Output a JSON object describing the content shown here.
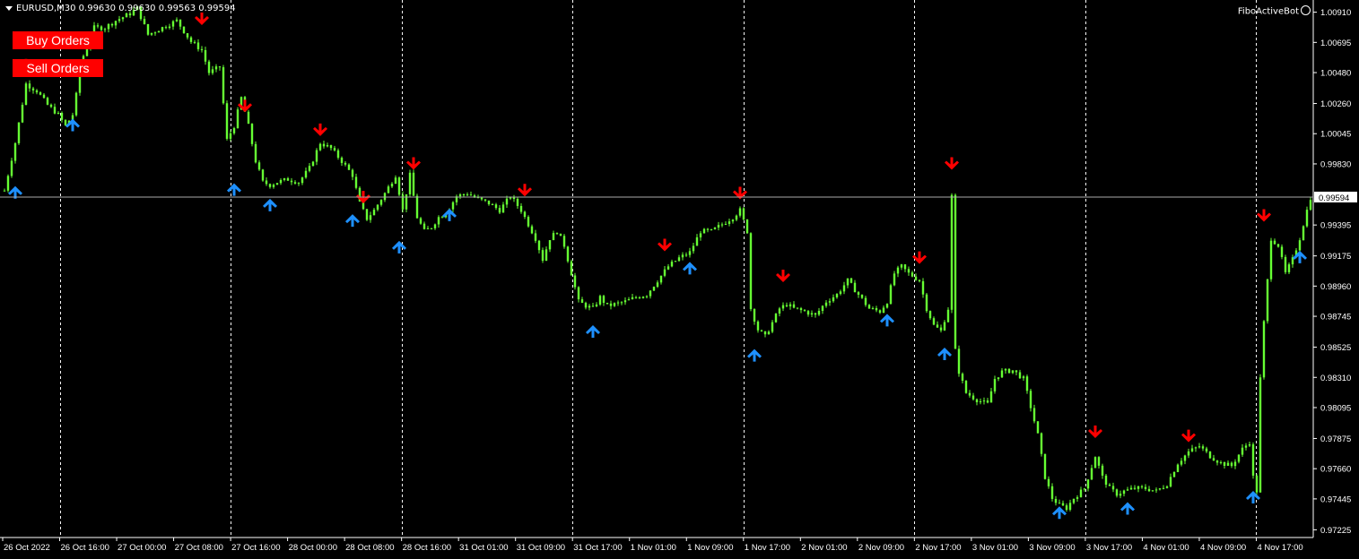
{
  "header": {
    "symbol_line": "EURUSD,M30  0.99630 0.99630 0.99563 0.99594",
    "bot_name": "FiboActiveBot"
  },
  "buttons": {
    "buy_label": "Buy Orders",
    "sell_label": "Sell Orders"
  },
  "colors": {
    "background": "#000000",
    "candles": "#66ff33",
    "down_arrow": "#ff0000",
    "up_arrow": "#1e90ff",
    "grid": "#ffffff",
    "button": "#ff0000"
  },
  "icons": {
    "buy_signal": "blue-up-arrow-icon",
    "sell_signal": "red-down-arrow-icon",
    "dropdown": "triangle-down-icon",
    "bot": "smiley-icon"
  },
  "chart_data": {
    "type": "candlestick",
    "symbol": "EURUSD",
    "timeframe": "M30",
    "grid": "vertical-dashed",
    "current_price": 0.99594,
    "current_price_label": "0.99594",
    "ylim": [
      0.9717,
      1.00965
    ],
    "y_ticks": [
      "1.00910",
      "1.00695",
      "1.00480",
      "1.00260",
      "1.00045",
      "0.99830",
      "0.99395",
      "0.99175",
      "0.98960",
      "0.98745",
      "0.98525",
      "0.98310",
      "0.98095",
      "0.97875",
      "0.97660",
      "0.97445",
      "0.97225"
    ],
    "x_ticks": [
      "26 Oct 2022",
      "26 Oct 16:00",
      "27 Oct 00:00",
      "27 Oct 08:00",
      "27 Oct 16:00",
      "28 Oct 00:00",
      "28 Oct 08:00",
      "28 Oct 16:00",
      "31 Oct 01:00",
      "31 Oct 09:00",
      "31 Oct 17:00",
      "1 Nov 01:00",
      "1 Nov 09:00",
      "1 Nov 17:00",
      "2 Nov 01:00",
      "2 Nov 09:00",
      "2 Nov 17:00",
      "3 Nov 01:00",
      "3 Nov 09:00",
      "3 Nov 17:00",
      "4 Nov 01:00",
      "4 Nov 09:00",
      "4 Nov 17:00"
    ],
    "bars_total": 365,
    "price_path": [
      [
        0,
        0.9964
      ],
      [
        3,
        0.9998
      ],
      [
        6,
        1.004
      ],
      [
        9,
        1.0035
      ],
      [
        12,
        1.0025
      ],
      [
        15,
        1.0018
      ],
      [
        17,
        1.001
      ],
      [
        19,
        1.0018
      ],
      [
        22,
        1.006
      ],
      [
        25,
        1.008
      ],
      [
        28,
        1.008
      ],
      [
        31,
        1.0085
      ],
      [
        35,
        1.009
      ],
      [
        37,
        1.0094
      ],
      [
        40,
        1.0075
      ],
      [
        44,
        1.008
      ],
      [
        48,
        1.0085
      ],
      [
        52,
        1.007
      ],
      [
        55,
        1.0064
      ],
      [
        57,
        1.0048
      ],
      [
        60,
        1.0052
      ],
      [
        62,
        1.0
      ],
      [
        64,
        1.001
      ],
      [
        66,
        1.003
      ],
      [
        68,
        1.001
      ],
      [
        70,
        0.9985
      ],
      [
        72,
        0.997
      ],
      [
        74,
        0.9968
      ],
      [
        76,
        0.997
      ],
      [
        79,
        0.9972
      ],
      [
        82,
        0.997
      ],
      [
        85,
        0.998
      ],
      [
        88,
        0.9998
      ],
      [
        91,
        0.9994
      ],
      [
        94,
        0.9985
      ],
      [
        97,
        0.9975
      ],
      [
        99,
        0.9955
      ],
      [
        101,
        0.9944
      ],
      [
        103,
        0.995
      ],
      [
        106,
        0.9962
      ],
      [
        109,
        0.9975
      ],
      [
        111,
        0.995
      ],
      [
        113,
        0.9975
      ],
      [
        115,
        0.9945
      ],
      [
        117,
        0.9935
      ],
      [
        119,
        0.9938
      ],
      [
        121,
        0.9945
      ],
      [
        123,
        0.9948
      ],
      [
        126,
        0.996
      ],
      [
        129,
        0.9962
      ],
      [
        132,
        0.9958
      ],
      [
        135,
        0.9955
      ],
      [
        138,
        0.995
      ],
      [
        141,
        0.996
      ],
      [
        144,
        0.995
      ],
      [
        146,
        0.994
      ],
      [
        148,
        0.993
      ],
      [
        150,
        0.9915
      ],
      [
        152,
        0.993
      ],
      [
        154,
        0.9935
      ],
      [
        156,
        0.9925
      ],
      [
        158,
        0.9905
      ],
      [
        160,
        0.9885
      ],
      [
        162,
        0.9882
      ],
      [
        164,
        0.988
      ],
      [
        166,
        0.9888
      ],
      [
        168,
        0.9882
      ],
      [
        170,
        0.9883
      ],
      [
        173,
        0.9885
      ],
      [
        176,
        0.9888
      ],
      [
        179,
        0.989
      ],
      [
        182,
        0.99
      ],
      [
        185,
        0.991
      ],
      [
        188,
        0.9916
      ],
      [
        191,
        0.992
      ],
      [
        194,
        0.9935
      ],
      [
        197,
        0.9935
      ],
      [
        200,
        0.994
      ],
      [
        203,
        0.9945
      ],
      [
        205,
        0.995
      ],
      [
        207,
        0.9935
      ],
      [
        208,
        0.988
      ],
      [
        210,
        0.9865
      ],
      [
        212,
        0.986
      ],
      [
        214,
        0.987
      ],
      [
        216,
        0.988
      ],
      [
        218,
        0.9883
      ],
      [
        220,
        0.988
      ],
      [
        223,
        0.9878
      ],
      [
        226,
        0.9875
      ],
      [
        229,
        0.9885
      ],
      [
        232,
        0.989
      ],
      [
        235,
        0.99
      ],
      [
        238,
        0.989
      ],
      [
        241,
        0.988
      ],
      [
        244,
        0.9878
      ],
      [
        246,
        0.9885
      ],
      [
        248,
        0.9905
      ],
      [
        250,
        0.991
      ],
      [
        252,
        0.9905
      ],
      [
        255,
        0.99
      ],
      [
        257,
        0.988
      ],
      [
        259,
        0.9868
      ],
      [
        261,
        0.9864
      ],
      [
        263,
        0.988
      ],
      [
        264,
        0.996
      ],
      [
        265,
        0.985
      ],
      [
        266,
        0.9835
      ],
      [
        268,
        0.982
      ],
      [
        271,
        0.9815
      ],
      [
        274,
        0.9812
      ],
      [
        276,
        0.983
      ],
      [
        278,
        0.9835
      ],
      [
        281,
        0.9836
      ],
      [
        284,
        0.983
      ],
      [
        286,
        0.981
      ],
      [
        288,
        0.979
      ],
      [
        290,
        0.976
      ],
      [
        292,
        0.9745
      ],
      [
        294,
        0.974
      ],
      [
        296,
        0.9738
      ],
      [
        298,
        0.9745
      ],
      [
        301,
        0.9752
      ],
      [
        304,
        0.9775
      ],
      [
        306,
        0.976
      ],
      [
        308,
        0.9752
      ],
      [
        310,
        0.9748
      ],
      [
        312,
        0.975
      ],
      [
        315,
        0.9752
      ],
      [
        318,
        0.9752
      ],
      [
        321,
        0.975
      ],
      [
        324,
        0.9755
      ],
      [
        327,
        0.977
      ],
      [
        330,
        0.9778
      ],
      [
        333,
        0.9782
      ],
      [
        336,
        0.9775
      ],
      [
        339,
        0.977
      ],
      [
        342,
        0.9768
      ],
      [
        345,
        0.978
      ],
      [
        347,
        0.9785
      ],
      [
        348,
        0.976
      ],
      [
        349,
        0.975
      ],
      [
        350,
        0.983
      ],
      [
        351,
        0.987
      ],
      [
        353,
        0.993
      ],
      [
        355,
        0.9925
      ],
      [
        357,
        0.9905
      ],
      [
        359,
        0.9915
      ],
      [
        361,
        0.993
      ],
      [
        363,
        0.995
      ],
      [
        364,
        0.9959
      ]
    ],
    "sell_signals": [
      {
        "bar": 6,
        "price": 1.0052
      },
      {
        "bar": 55,
        "price": 1.0085
      },
      {
        "bar": 67,
        "price": 1.0023
      },
      {
        "bar": 88,
        "price": 1.0006
      },
      {
        "bar": 100,
        "price": 0.9958
      },
      {
        "bar": 114,
        "price": 0.9982
      },
      {
        "bar": 145,
        "price": 0.9963
      },
      {
        "bar": 184,
        "price": 0.9924
      },
      {
        "bar": 205,
        "price": 0.9961
      },
      {
        "bar": 217,
        "price": 0.9902
      },
      {
        "bar": 255,
        "price": 0.9915
      },
      {
        "bar": 264,
        "price": 0.9982
      },
      {
        "bar": 304,
        "price": 0.9791
      },
      {
        "bar": 330,
        "price": 0.9788
      },
      {
        "bar": 351,
        "price": 0.9945
      }
    ],
    "buy_signals": [
      {
        "bar": 3,
        "price": 0.9964
      },
      {
        "bar": 19,
        "price": 1.0012
      },
      {
        "bar": 64,
        "price": 0.9966
      },
      {
        "bar": 74,
        "price": 0.9955
      },
      {
        "bar": 97,
        "price": 0.9944
      },
      {
        "bar": 110,
        "price": 0.9925
      },
      {
        "bar": 124,
        "price": 0.9948
      },
      {
        "bar": 164,
        "price": 0.9865
      },
      {
        "bar": 191,
        "price": 0.991
      },
      {
        "bar": 209,
        "price": 0.9848
      },
      {
        "bar": 246,
        "price": 0.9873
      },
      {
        "bar": 262,
        "price": 0.9849
      },
      {
        "bar": 294,
        "price": 0.9736
      },
      {
        "bar": 313,
        "price": 0.9739
      },
      {
        "bar": 348,
        "price": 0.9747
      },
      {
        "bar": 361,
        "price": 0.9918
      }
    ]
  }
}
